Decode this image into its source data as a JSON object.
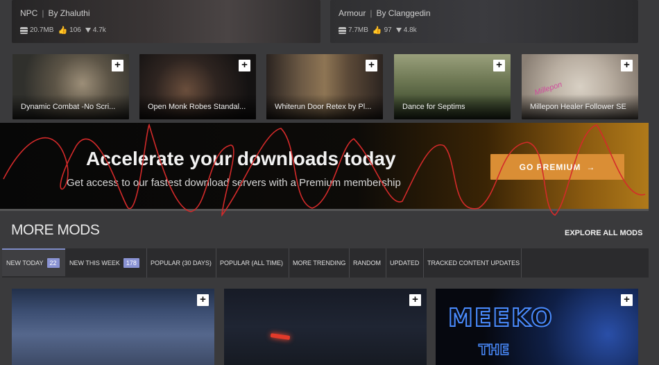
{
  "top_cards": [
    {
      "category": "NPC",
      "author": "By Zhaluthi",
      "size": "20.7MB",
      "endorsements": "106",
      "downloads": "4.7k"
    },
    {
      "category": "Armour",
      "author": "By Clanggedin",
      "size": "7.7MB",
      "endorsements": "97",
      "downloads": "4.8k"
    }
  ],
  "featured_thumbs": [
    {
      "title": "Dynamic Combat -No Scri..."
    },
    {
      "title": "Open Monk Robes Standal..."
    },
    {
      "title": "Whiterun Door Retex by Pl..."
    },
    {
      "title": "Dance for Septims"
    },
    {
      "title": "Millepon Healer Follower SE"
    }
  ],
  "thumb_logo_text": "Millepon",
  "banner": {
    "headline": "Accelerate your downloads today",
    "subline": "Get access to our fastest download servers with a Premium membership",
    "cta_label": "GO PREMIUM",
    "cta_arrow": "→"
  },
  "more_mods": {
    "title": "MORE MODS",
    "explore_label": "EXPLORE ALL MODS",
    "tabs": [
      {
        "label": "NEW TODAY",
        "badge": "22",
        "active": true
      },
      {
        "label": "NEW THIS WEEK",
        "badge": "178"
      },
      {
        "label": "POPULAR (30 DAYS)"
      },
      {
        "label": "POPULAR (ALL TIME)"
      },
      {
        "label": "MORE TRENDING"
      },
      {
        "label": "RANDOM"
      },
      {
        "label": "UPDATED"
      },
      {
        "label": "TRACKED CONTENT UPDATES"
      }
    ]
  },
  "bottom_cards": [
    {
      "text": ""
    },
    {
      "text": ""
    },
    {
      "text_line1": "MEEKO",
      "text_line2": "THE"
    }
  ],
  "icons": {
    "add": "plus-icon",
    "size": "storage-icon",
    "endorse": "thumbs-up-icon",
    "downloads": "download-icon"
  },
  "colors": {
    "accent": "#da8e35",
    "tab_badge": "#8a93d4",
    "scribble": "#d42a2a"
  }
}
